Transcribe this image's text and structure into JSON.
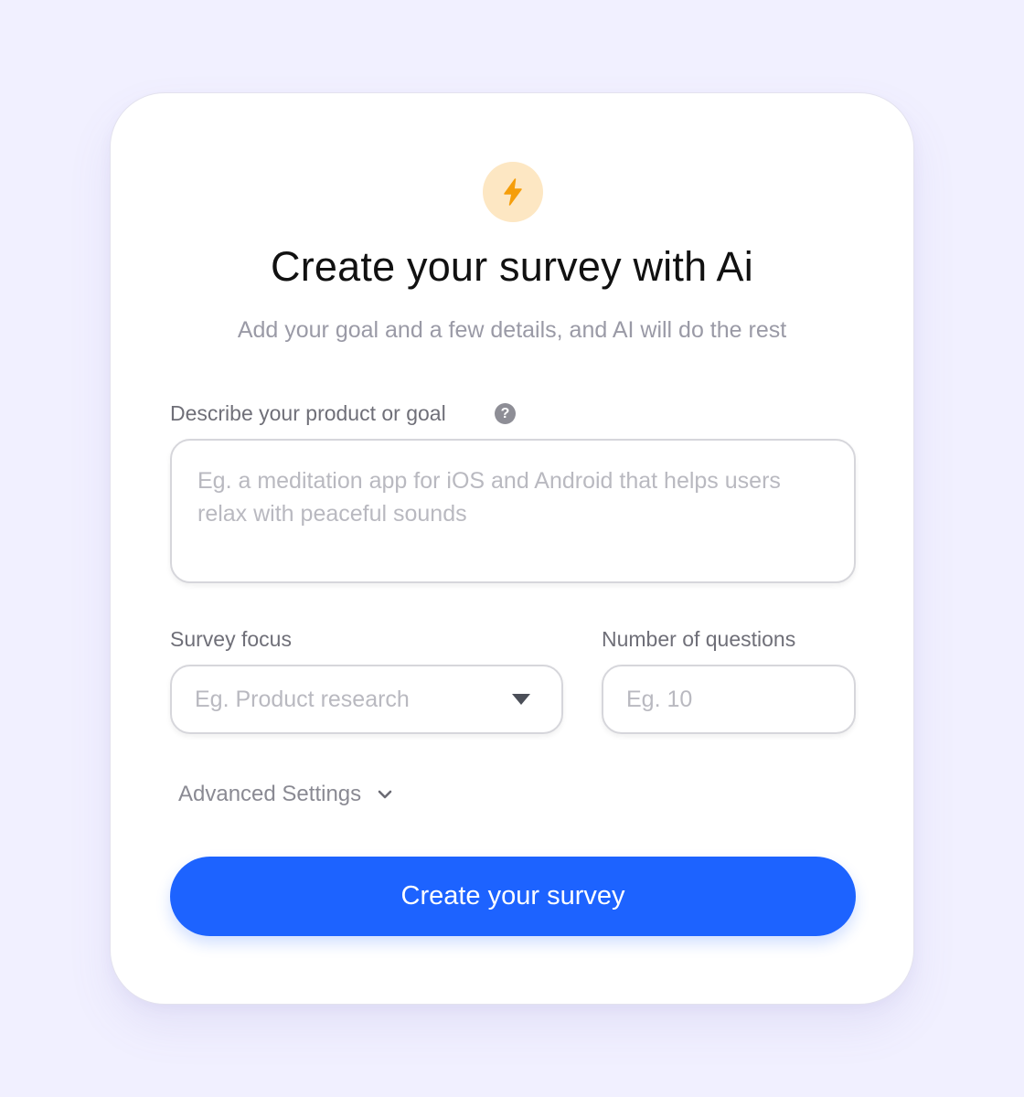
{
  "header": {
    "icon": "lightning-bolt-icon",
    "badge_color": "#fde7c3",
    "icon_color": "#f59e0b",
    "title": "Create your survey with Ai",
    "subtitle": "Add your goal and a few details, and AI will do the rest"
  },
  "form": {
    "description": {
      "label": "Describe your product or goal",
      "help_icon": "question-mark-icon",
      "help_glyph": "?",
      "value": "",
      "placeholder": "Eg. a meditation app for iOS and Android that helps users relax with peaceful sounds"
    },
    "focus": {
      "label": "Survey focus",
      "placeholder": "Eg. Product research",
      "icon": "dropdown-caret-icon"
    },
    "questions": {
      "label": "Number of questions",
      "value": "",
      "placeholder": "Eg. 10"
    },
    "advanced": {
      "label": "Advanced Settings",
      "icon": "chevron-down-icon"
    },
    "submit_label": "Create your survey"
  },
  "colors": {
    "page_background": "#f1f0ff",
    "card_background": "#ffffff",
    "primary": "#1d63ff"
  }
}
